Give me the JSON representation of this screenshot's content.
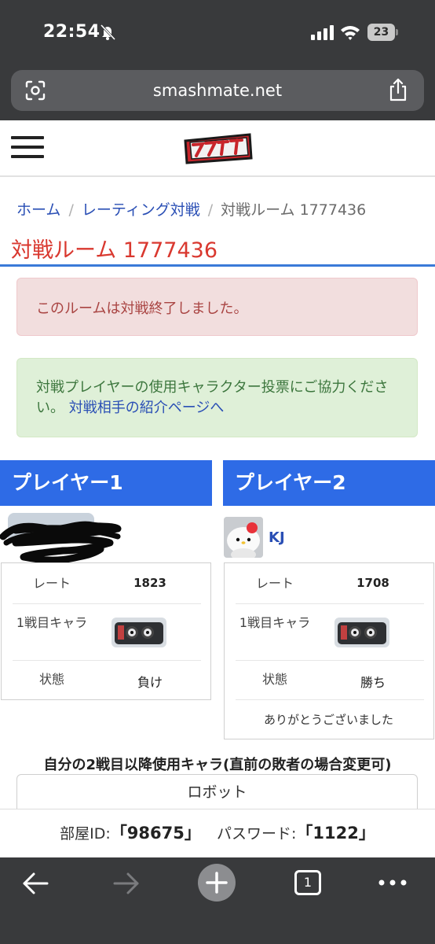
{
  "status_bar": {
    "time": "22:54",
    "battery": "23"
  },
  "browser": {
    "url": "smashmate.net"
  },
  "breadcrumb": {
    "home": "ホーム",
    "sep": "/",
    "rating": "レーティング対戦",
    "current": "対戦ルーム 1777436"
  },
  "page_title": "対戦ルーム 1777436",
  "alert_finished": "このルームは対戦終了しました。",
  "alert_vote": {
    "text": "対戦プレイヤーの使用キャラクター投票にご協力ください。",
    "link": "対戦相手の紹介ページへ"
  },
  "player1": {
    "heading": "プレイヤー1",
    "rate_label": "レート",
    "rate": "1823",
    "chara_label": "1戦目キャラ",
    "status_label": "状態",
    "status": "負け"
  },
  "player2": {
    "heading": "プレイヤー2",
    "name": "KJ",
    "rate_label": "レート",
    "rate": "1708",
    "chara_label": "1戦目キャラ",
    "status_label": "状態",
    "status": "勝ち",
    "message": "ありがとうございました"
  },
  "second_chara": {
    "label": "自分の2戦目以降使用キャラ(直前の敗者の場合変更可)",
    "selected": "ロボット"
  },
  "room_info": {
    "room_id_label": "部屋ID:",
    "room_id": "「98675」",
    "password_label": "パスワード:",
    "password": "「1122」"
  },
  "toolbar": {
    "tab_count": "1"
  },
  "icons": {
    "bell": "bell-off-icon",
    "signal": "signal-icon",
    "wifi": "wifi-icon",
    "lens": "lens-icon",
    "share": "share-icon",
    "menu": "hamburger-menu-icon",
    "back": "back-arrow-icon",
    "forward": "forward-arrow-icon",
    "new_tab": "plus-icon",
    "more": "more-icon"
  },
  "colors": {
    "accent_blue": "#2e6be6",
    "title_red": "#d9382f",
    "link_blue": "#2a4fb5"
  }
}
